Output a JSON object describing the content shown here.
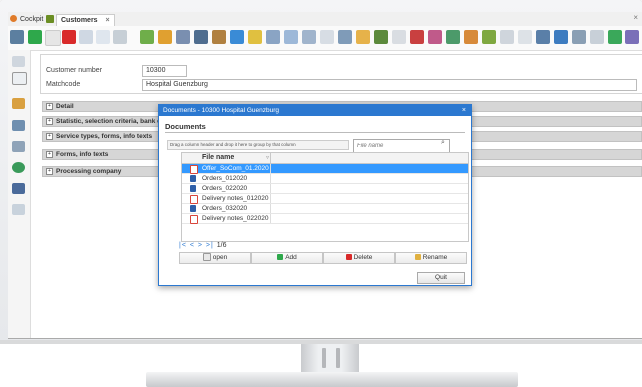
{
  "tabs": {
    "cockpit": "Cockpit",
    "customers": "Customers",
    "close": "×"
  },
  "window_close": "×",
  "form": {
    "customer_number_label": "Customer number",
    "customer_number_value": "10300",
    "matchcode_label": "Matchcode",
    "matchcode_value": "Hospital Guenzburg"
  },
  "sections": [
    "Detail",
    "Statistic, selection criteria, bank det",
    "Service types, forms, info texts",
    "Forms, info texts",
    "Processing company"
  ],
  "section_expander": "+",
  "dialog": {
    "title": "Documents - 10300 Hospital Guenzburg",
    "close": "×",
    "heading": "Documents",
    "group_hint": "Drag a column header and drop it here to group by that column",
    "search_placeholder": "File name",
    "column_header": "File name",
    "files": [
      {
        "name": "Offer_SoCom_01.2020",
        "type": "pdf",
        "selected": true
      },
      {
        "name": "Orders_012020",
        "type": "word",
        "selected": false
      },
      {
        "name": "Orders_022020",
        "type": "word",
        "selected": false
      },
      {
        "name": "Delivery notes_012020",
        "type": "pdf",
        "selected": false
      },
      {
        "name": "Orders_032020",
        "type": "word",
        "selected": false
      },
      {
        "name": "Delivery notes_022020",
        "type": "pdf",
        "selected": false
      }
    ],
    "pager_controls": "|< < > >|",
    "pager_count": "1/6",
    "buttons": {
      "open": "open",
      "add": "Add",
      "delete": "Delete",
      "rename": "Rename",
      "quit": "Quit"
    }
  },
  "colors": {
    "accent": "#2b78d0",
    "selection": "#3399ff",
    "pdf_icon": "#d9453a",
    "word_icon": "#2f5fa8"
  }
}
